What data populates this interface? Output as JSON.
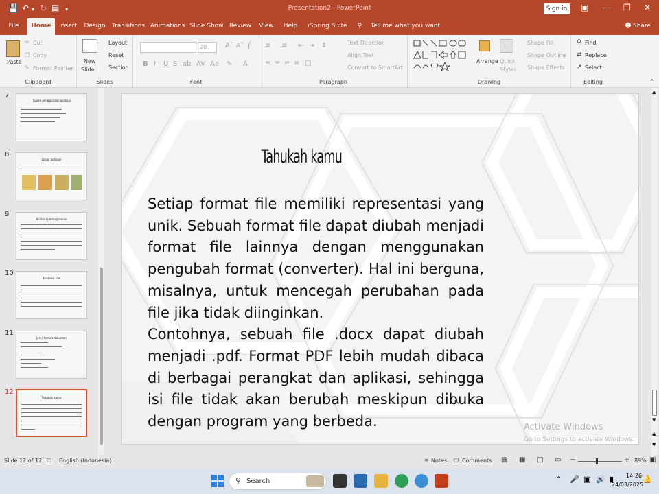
{
  "window": {
    "title": "Presentation2 - PowerPoint",
    "signin": "Sign in"
  },
  "tabs": [
    "File",
    "Home",
    "Insert",
    "Design",
    "Transitions",
    "Animations",
    "Slide Show",
    "Review",
    "View",
    "Help",
    "iSpring Suite 11"
  ],
  "tell_me": "Tell me what you want to do",
  "share": "Share",
  "ribbon": {
    "clipboard": {
      "paste": "Paste",
      "cut": "Cut",
      "copy": "Copy",
      "format_painter": "Format Painter",
      "label": "Clipboard"
    },
    "slides": {
      "new_slide": "New",
      "new_slide2": "Slide",
      "layout": "Layout",
      "reset": "Reset",
      "section": "Section",
      "label": "Slides"
    },
    "font": {
      "size": "28",
      "label": "Font"
    },
    "paragraph": {
      "text_direction": "Text Direction",
      "align_text": "Align Text",
      "smartart": "Convert to SmartArt",
      "label": "Paragraph"
    },
    "drawing": {
      "arrange": "Arrange",
      "quick": "Quick",
      "styles": "Styles",
      "shape_fill": "Shape Fill",
      "shape_outline": "Shape Outline",
      "shape_effects": "Shape Effects",
      "label": "Drawing"
    },
    "editing": {
      "find": "Find",
      "replace": "Replace",
      "select": "Select",
      "label": "Editing"
    }
  },
  "thumbnails": [
    {
      "num": "7",
      "title": "Tujuan penggunaan aplikasi"
    },
    {
      "num": "8",
      "title": "Dasar aplikasi"
    },
    {
      "num": "9",
      "title": "Aplikasi pemrograman"
    },
    {
      "num": "10",
      "title": "Ekstensi File"
    },
    {
      "num": "11",
      "title": "Jenis format dokumen"
    },
    {
      "num": "12",
      "title": "Tahukah kamu"
    }
  ],
  "slide": {
    "title": "Tahukah kamu",
    "p1": "Setiap format file memiliki representasi yang unik. Sebuah format file dapat diubah menjadi format file lainnya dengan menggunakan pengubah format (converter). Hal ini berguna, misalnya, untuk mencegah perubahan pada file jika tidak diinginkan.",
    "p2": "Contohnya, sebuah file .docx dapat diubah menjadi .pdf. Format PDF lebih mudah dibaca di berbagai perangkat dan aplikasi, sehingga isi file tidak akan berubah meskipun dibuka dengan program yang berbeda."
  },
  "watermark": {
    "line1": "Activate Windows",
    "line2": "Go to Settings to activate Windows."
  },
  "status": {
    "slide": "Slide 12 of 12",
    "language": "English (Indonesia)",
    "notes": "Notes",
    "comments": "Comments",
    "zoom": "89%"
  },
  "taskbar": {
    "search": "Search",
    "time": "14:26",
    "date": "24/03/2025"
  }
}
